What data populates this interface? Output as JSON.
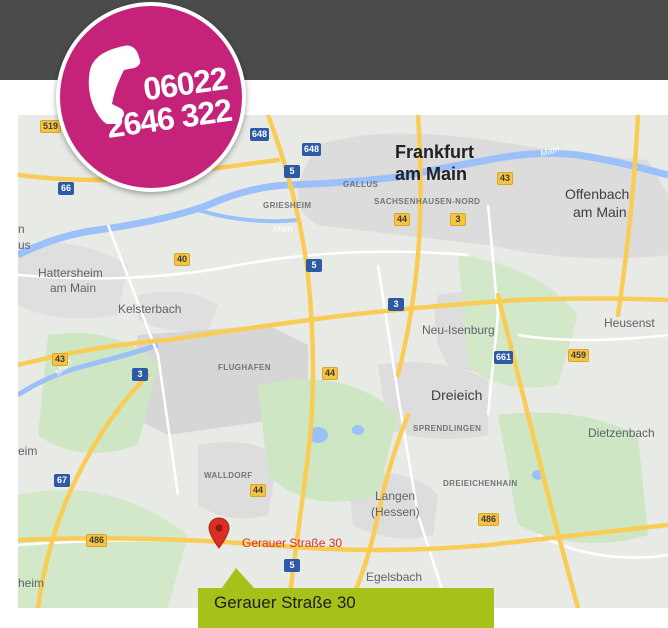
{
  "header": {
    "bar_color": "#4b4b4b"
  },
  "phone_badge": {
    "line1": "06022",
    "line2": "2646 322",
    "color": "#c5237a",
    "icon": "phone-handset-icon"
  },
  "map": {
    "places": {
      "frankfurt_1": "Frankfurt",
      "frankfurt_2": "am Main",
      "offenbach_1": "Offenbach",
      "offenbach_2": "am Main",
      "hattersheim_1": "Hattersheim",
      "hattersheim_2": "am Main",
      "kelsterbach": "Kelsterbach",
      "neu_isenburg": "Neu-Isenburg",
      "heusenstamm": "Heusenst",
      "dreieich": "Dreieich",
      "dietzenbach": "Dietzenbach",
      "langen_1": "Langen",
      "langen_2": "(Hessen)",
      "egelsbach": "Egelsbach",
      "edge_n": "n",
      "edge_us": "us",
      "edge_heim_left": "eim",
      "edge_heim_bottom": "heim"
    },
    "districts": {
      "gallus": "GALLUS",
      "griesheim": "GRIESHEIM",
      "sachsenhausen": "SACHSENHAUSEN-NORD",
      "flughafen": "FLUGHAFEN",
      "sprendlingen": "SPRENDLINGEN",
      "walldorf": "WALLDORF",
      "dreieichenhain": "DREIEICHENHAIN"
    },
    "rivers": {
      "main_1": "Main",
      "main_2": "Main",
      "main_3": "Main"
    },
    "shields": {
      "s519": "519",
      "s648a": "648",
      "s648b": "648",
      "s66": "66",
      "s5a": "5",
      "s43a": "43",
      "s44a": "44",
      "s3a": "3",
      "s40": "40",
      "s5b": "5",
      "s3b": "3",
      "s661": "661",
      "s459": "459",
      "s43b": "43",
      "s3c": "3",
      "s44b": "44",
      "s67": "67",
      "s44c": "44",
      "s486a": "486",
      "s486b": "486",
      "s5c": "5"
    },
    "pin": {
      "label": "Gerauer Straße 30",
      "color": "#d93025"
    }
  },
  "callout": {
    "text": "Gerauer Straße 30",
    "color": "#a6c21a"
  }
}
